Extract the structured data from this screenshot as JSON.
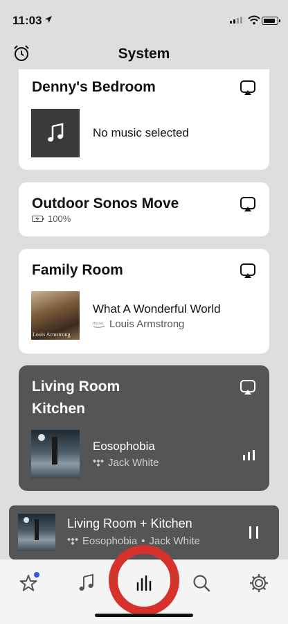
{
  "status_bar": {
    "time": "11:03"
  },
  "header": {
    "title": "System"
  },
  "rooms": [
    {
      "name": "Denny's Bedroom",
      "track": "No music selected"
    },
    {
      "name": "Outdoor Sonos Move",
      "battery": "100%"
    },
    {
      "name": "Family Room",
      "track": "What A Wonderful World",
      "artist": "Louis Armstrong",
      "album_art_text": "Louis Armstrong"
    },
    {
      "name_line1": "Living Room",
      "name_line2": "Kitchen",
      "track": "Eosophobia",
      "artist": "Jack White"
    }
  ],
  "mini_player": {
    "title": "Living Room + Kitchen",
    "track": "Eosophobia",
    "separator": "•",
    "artist": "Jack White"
  },
  "tabs": [
    {
      "icon": "star-icon"
    },
    {
      "icon": "music-note-icon"
    },
    {
      "icon": "rooms-bars-icon",
      "selected": true
    },
    {
      "icon": "search-icon"
    },
    {
      "icon": "gear-icon"
    }
  ],
  "colors": {
    "highlight_ring": "#d4322a",
    "dark_card": "#555555",
    "notification_dot": "#2f5bd6"
  }
}
